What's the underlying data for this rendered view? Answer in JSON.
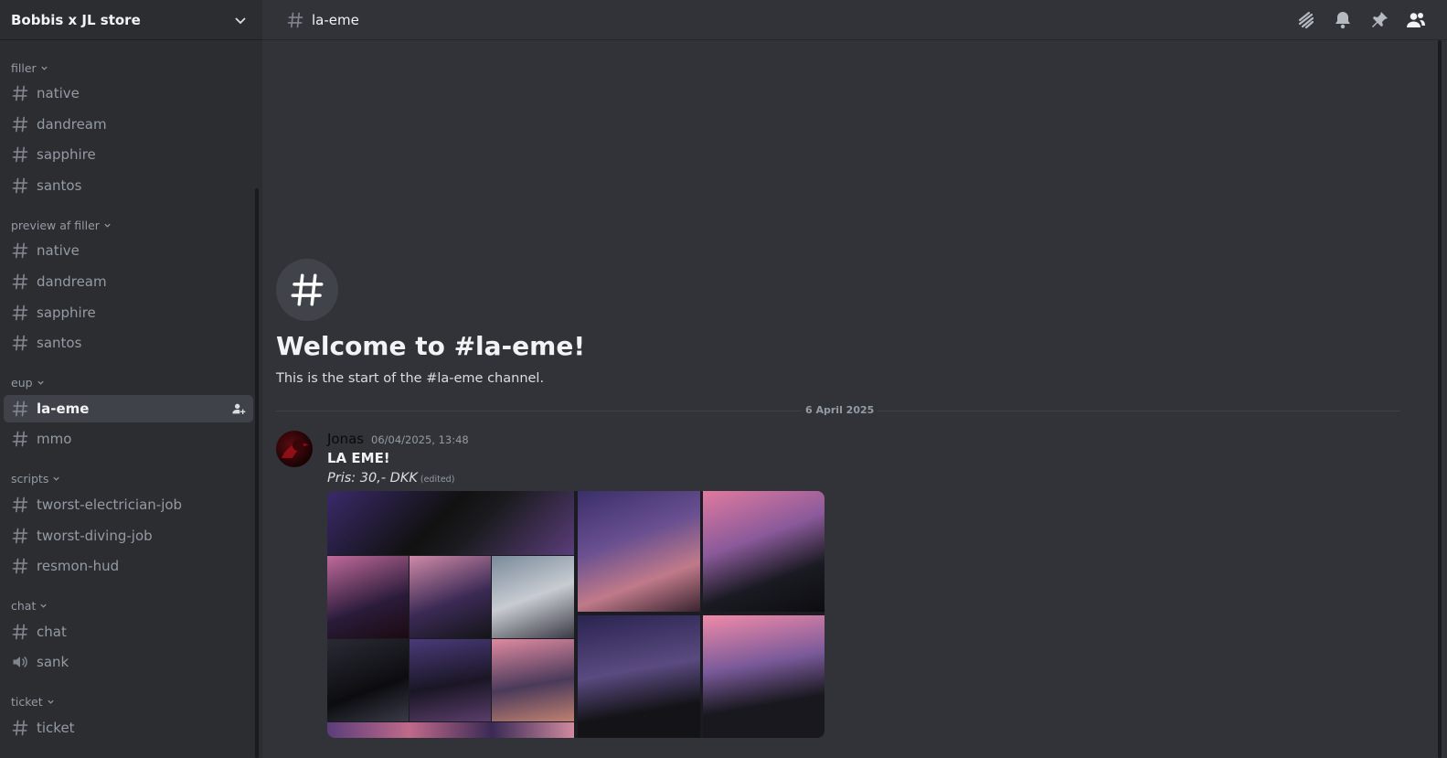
{
  "server": {
    "name": "Bobbis x JL store"
  },
  "categories": [
    {
      "label": "filler",
      "channels": [
        "native",
        "dandream",
        "sapphire",
        "santos"
      ]
    },
    {
      "label": "preview af filler",
      "channels": [
        "native",
        "dandream",
        "sapphire",
        "santos"
      ]
    },
    {
      "label": "eup",
      "channels": [
        "la-eme",
        "mmo"
      ]
    },
    {
      "label": "scripts",
      "channels": [
        "tworst-electrician-job",
        "tworst-diving-job",
        "resmon-hud"
      ]
    },
    {
      "label": "chat",
      "channels": [
        "chat",
        "sank"
      ]
    },
    {
      "label": "ticket",
      "channels": [
        "ticket"
      ]
    }
  ],
  "active_channel": "la-eme",
  "header": {
    "channel_name": "la-eme"
  },
  "welcome": {
    "title": "Welcome to #la-eme!",
    "subtitle": "This is the start of the #la-eme channel."
  },
  "date_divider": "6 April 2025",
  "message": {
    "author": "Jonas",
    "timestamp": "06/04/2025, 13:48",
    "title": "LA EME!",
    "price": "Pris: 30,- DKK",
    "edited": "(edited)"
  },
  "icons": {
    "top_bar": [
      "threads-icon",
      "bell-icon",
      "pin-icon",
      "members-icon"
    ]
  },
  "colors": {
    "sidebar_bg": "#2b2d31",
    "main_bg": "#313338",
    "active_channel_bg": "#404249",
    "muted_text": "#949ba4"
  }
}
